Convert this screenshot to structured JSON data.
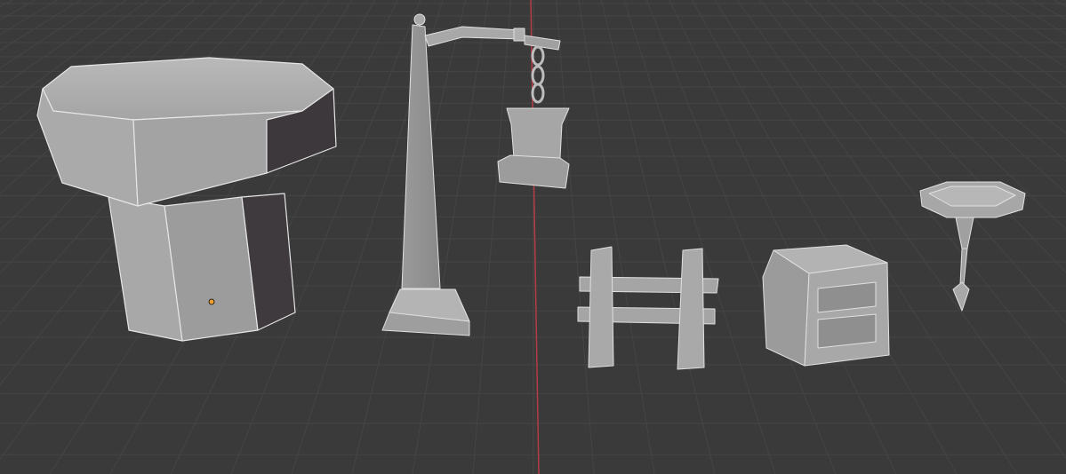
{
  "viewport": {
    "name": "3d-viewport",
    "background": "#3a3a3a",
    "grid_color": "#454545",
    "y_axis_color": "#b43c46",
    "mesh_color": "#a6a6a6",
    "origin_color": "#f0a030"
  },
  "objects": [
    {
      "name": "mushroom-stump-mesh"
    },
    {
      "name": "lamp-post-mesh"
    },
    {
      "name": "fence-mesh"
    },
    {
      "name": "crate-mesh"
    },
    {
      "name": "round-table-mesh"
    }
  ]
}
